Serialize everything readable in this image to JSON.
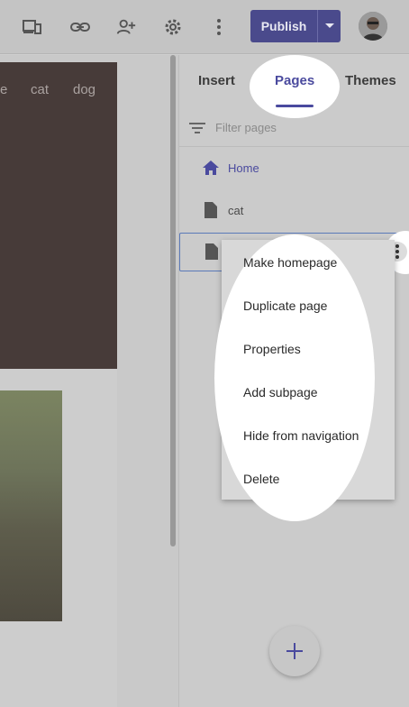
{
  "toolbar": {
    "icons": [
      "devices-preview-icon",
      "link-icon",
      "add-person-icon",
      "settings-gear-icon",
      "more-vert-icon"
    ],
    "publish_label": "Publish",
    "accent_color": "#4a4a8c"
  },
  "preview": {
    "nav_items": [
      "e",
      "cat",
      "dog"
    ],
    "hero_color": "#473b39"
  },
  "panel": {
    "tabs": [
      {
        "label": "Insert",
        "active": false
      },
      {
        "label": "Pages",
        "active": true
      },
      {
        "label": "Themes",
        "active": false
      }
    ],
    "filter_placeholder": "Filter pages",
    "pages": [
      {
        "label": "Home",
        "icon": "home-icon",
        "is_home": true
      },
      {
        "label": "cat",
        "icon": "page-icon",
        "is_home": false
      },
      {
        "label": "",
        "icon": "page-icon",
        "is_home": false,
        "selected": true
      }
    ]
  },
  "context_menu": {
    "items": [
      {
        "label": "Make homepage"
      },
      {
        "label": "Duplicate page"
      },
      {
        "label": "Properties"
      },
      {
        "label": "Add subpage"
      },
      {
        "label": "Hide from navigation"
      },
      {
        "label": "Delete"
      }
    ]
  }
}
